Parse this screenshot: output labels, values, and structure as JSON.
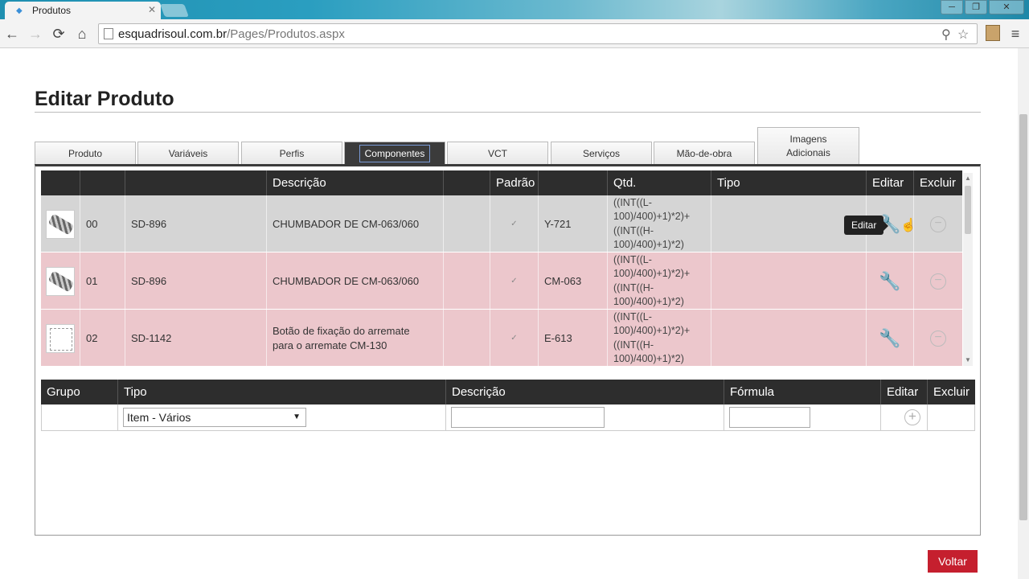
{
  "browser": {
    "tab_title": "Produtos",
    "tab_close": "✕",
    "url_domain": "esquadrisoul.com.br",
    "url_path": "/Pages/Produtos.aspx",
    "nav": {
      "back": "←",
      "forward": "→",
      "reload": "⟳",
      "home": "⌂"
    },
    "winbtns": {
      "min": "─",
      "max": "❐",
      "close": "✕"
    }
  },
  "page": {
    "title": "Editar Produto",
    "tabs": [
      {
        "label": "Produto"
      },
      {
        "label": "Variáveis"
      },
      {
        "label": "Perfis"
      },
      {
        "label": "Componentes"
      },
      {
        "label": "VCT"
      },
      {
        "label": "Serviços"
      },
      {
        "label": "Mão-de-obra"
      },
      {
        "label_line1": "Imagens",
        "label_line2": "Adicionais"
      }
    ],
    "active_tab": "Componentes"
  },
  "components_grid": {
    "headers": [
      "",
      "",
      "",
      "Descrição",
      "",
      "Padrão",
      "",
      "Qtd.",
      "Tipo",
      "Editar",
      "Excluir"
    ],
    "rows": [
      {
        "seq": "00",
        "code": "SD-896",
        "desc_line1": "CHUMBADOR DE CM-063/060",
        "desc_line2": "",
        "padrao": "✓",
        "ref": "Y-721",
        "qtd": [
          "((INT((L-",
          "100)/400)+1)*2)+",
          "((INT((H-",
          "100)/400)+1)*2)"
        ],
        "tipo": ""
      },
      {
        "seq": "01",
        "code": "SD-896",
        "desc_line1": "CHUMBADOR DE CM-063/060",
        "desc_line2": "",
        "padrao": "✓",
        "ref": "CM-063",
        "qtd": [
          "((INT((L-",
          "100)/400)+1)*2)+",
          "((INT((H-",
          "100)/400)+1)*2)"
        ],
        "tipo": ""
      },
      {
        "seq": "02",
        "code": "SD-1142",
        "desc_line1": "Botão de fixação do arremate",
        "desc_line2": "para o arremate CM-130",
        "padrao": "✓",
        "ref": "E-613",
        "qtd": [
          "((INT((L-",
          "100)/400)+1)*2)+",
          "((INT((H-",
          "100)/400)+1)*2)"
        ],
        "tipo": ""
      }
    ],
    "tooltip": "Editar"
  },
  "groups_grid": {
    "headers": [
      "Grupo",
      "Tipo",
      "Descrição",
      "Fórmula",
      "Editar",
      "Excluir"
    ],
    "tipo_selected": "Item - Vários"
  },
  "actions": {
    "voltar": "Voltar"
  },
  "icons": {
    "wrench": "🔧",
    "minus": "−",
    "plus": "+",
    "check": "✓",
    "select_arrow": "▼",
    "scroll_up": "▲",
    "scroll_down": "▼"
  },
  "colors": {
    "pink_row": "#ecc7cc",
    "gray_row": "#d5d5d5",
    "header_dark": "#2d2d2d",
    "voltar_red": "#c51f2e"
  }
}
